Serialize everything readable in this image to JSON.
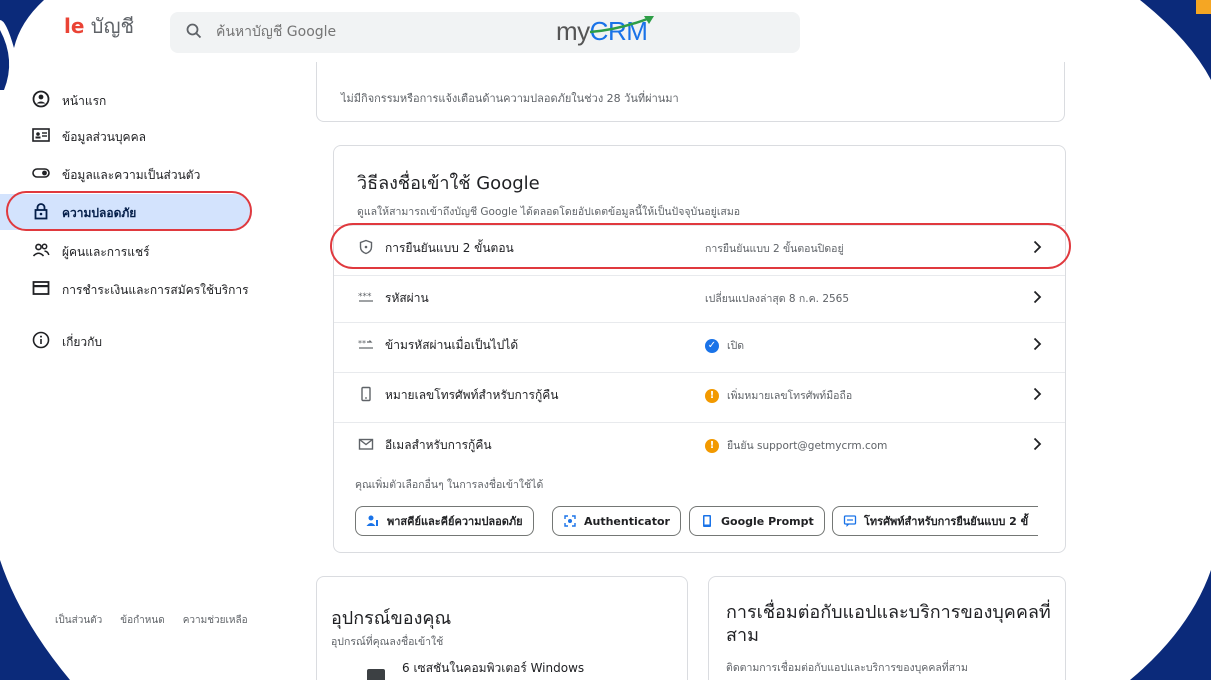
{
  "header": {
    "logo_g": "le",
    "logo_rest": " บัญชี",
    "search_placeholder": "ค้นหาบัญชี Google",
    "brand_my": "my",
    "brand_crm": "CRM"
  },
  "sidebar": {
    "items": [
      {
        "label": "หน้าแรก",
        "icon": "home-icon"
      },
      {
        "label": "ข้อมูลส่วนบุคคล",
        "icon": "personal-info-icon"
      },
      {
        "label": "ข้อมูลและความเป็นส่วนตัว",
        "icon": "privacy-toggle-icon"
      },
      {
        "label": "ความปลอดภัย",
        "icon": "lock-icon"
      },
      {
        "label": "ผู้คนและการแชร์",
        "icon": "people-icon"
      },
      {
        "label": "การชำระเงินและการสมัครใช้บริการ",
        "icon": "credit-card-icon"
      },
      {
        "label": "เกี่ยวกับ",
        "icon": "info-icon"
      }
    ],
    "footer": [
      "เป็นส่วนตัว",
      "ข้อกำหนด",
      "ความช่วยเหลือ"
    ]
  },
  "activity_card": {
    "text": "ไม่มีกิจกรรมหรือการแจ้งเตือนด้านความปลอดภัยในช่วง 28 วันที่ผ่านมา"
  },
  "signin_card": {
    "title": "วิธีลงชื่อเข้าใช้ Google",
    "desc": "ดูแลให้สามารถเข้าถึงบัญชี Google ได้ตลอดโดยอัปเดตข้อมูลนี้ให้เป็นปัจจุบันอยู่เสมอ",
    "rows": [
      {
        "label": "การยืนยันแบบ 2 ขั้นตอน",
        "value": "การยืนยันแบบ 2 ขั้นตอนปิดอยู่",
        "icon": "shield-icon",
        "status": ""
      },
      {
        "label": "รหัสผ่าน",
        "value": "เปลี่ยนแปลงล่าสุด 8 ก.ค. 2565",
        "icon": "password-icon",
        "status": ""
      },
      {
        "label": "ข้ามรหัสผ่านเมื่อเป็นไปได้",
        "value": "เปิด",
        "icon": "skip-password-icon",
        "status": "ok"
      },
      {
        "label": "หมายเลขโทรศัพท์สำหรับการกู้คืน",
        "value": "เพิ่มหมายเลขโทรศัพท์มือถือ",
        "icon": "phone-icon",
        "status": "warn"
      },
      {
        "label": "อีเมลสำหรับการกู้คืน",
        "value": "ยืนยัน support@getmycrm.com",
        "icon": "mail-icon",
        "status": "warn"
      }
    ],
    "hint": "คุณเพิ่มตัวเลือกอื่นๆ ในการลงชื่อเข้าใช้ได้",
    "chips": [
      {
        "label": "พาสคีย์และคีย์ความปลอดภัย",
        "icon": "passkey-icon"
      },
      {
        "label": "Authenticator",
        "icon": "authenticator-icon"
      },
      {
        "label": "Google Prompt",
        "icon": "google-prompt-icon"
      },
      {
        "label": "โทรศัพท์สำหรับการยืนยันแบบ 2 ขั้",
        "icon": "sms-icon"
      }
    ]
  },
  "devices_card": {
    "title": "อุปกรณ์ของคุณ",
    "desc": "อุปกรณ์ที่คุณลงชื่อเข้าใช้",
    "device": "6 เซสชันในคอมพิวเตอร์ Windows"
  },
  "thirdparty_card": {
    "title": "การเชื่อมต่อกับแอปและบริการของบุคคลที่สาม",
    "desc": "ติดตามการเชื่อมต่อกับแอปและบริการของบุคคลที่สาม"
  },
  "colors": {
    "accent": "#1a73e8",
    "highlight_ring": "#e0393e",
    "active_nav": "#d3e3fd",
    "frame": "#0b2a7a"
  }
}
